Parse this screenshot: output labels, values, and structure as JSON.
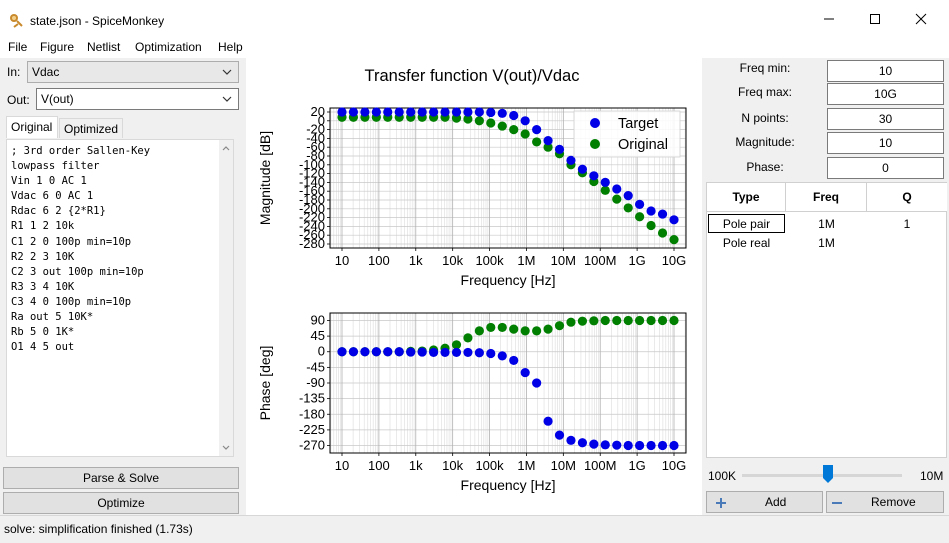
{
  "window": {
    "title": "state.json - SpiceMonkey",
    "minimize": "—",
    "maximize": "☐",
    "close": "✕"
  },
  "menu": [
    "File",
    "Figure",
    "Netlist",
    "Optimization",
    "Help"
  ],
  "left_panel": {
    "in_label": "In:",
    "in_value": "Vdac",
    "out_label": "Out:",
    "out_value": "V(out)",
    "tabs": [
      "Original",
      "Optimized"
    ],
    "netlist_lines": [
      "; 3rd order Sallen-Key",
      "lowpass filter",
      "Vin 1 0 AC 1",
      "Vdac 6 0 AC 1",
      "Rdac 6 2 {2*R1}",
      "R1 1 2 10k",
      "C1 2 0 100p min=10p",
      "R2 2 3 10K",
      "C2 3 out 100p min=10p",
      "R3 3 4 10K",
      "C3 4 0 100p min=10p",
      "Ra out 5 10K*",
      "Rb 5 0 1K*",
      "O1 4 5 out"
    ],
    "parse_button": "Parse & Solve",
    "optimize_button": "Optimize"
  },
  "right_panel": {
    "params": [
      {
        "label": "Freq min:",
        "value": "10"
      },
      {
        "label": "Freq max:",
        "value": "10G"
      },
      {
        "label": "N points:",
        "value": "30"
      },
      {
        "label": "Magnitude:",
        "value": "10"
      },
      {
        "label": "Phase:",
        "value": "0"
      }
    ],
    "table_headers": [
      "Type",
      "Freq",
      "Q"
    ],
    "table_rows": [
      {
        "type": "Pole pair",
        "freq": "1M",
        "q": "1"
      },
      {
        "type": "Pole real",
        "freq": "1M",
        "q": ""
      }
    ],
    "slider_min": "100K",
    "slider_max": "10M",
    "slider_level": 0.54,
    "add_button": "Add",
    "remove_button": "Remove"
  },
  "status": "solve: simplification finished (1.73s)",
  "chart_data": [
    {
      "type": "scatter",
      "title": "Transfer function V(out)/Vdac",
      "xlabel": "Frequency [Hz]",
      "ylabel": "Magnitude [dB]",
      "xscale": "log",
      "xlim": [
        10,
        10000000000
      ],
      "ylim": [
        -280,
        20
      ],
      "xticks": [
        "10",
        "100",
        "1k",
        "10k",
        "100k",
        "1M",
        "10M",
        "100M",
        "1G",
        "10G"
      ],
      "yticks": [
        "20",
        "0",
        "-20",
        "-40",
        "-60",
        "-80",
        "-100",
        "-120",
        "-140",
        "-160",
        "-180",
        "-200",
        "-220",
        "-240",
        "-260",
        "-280"
      ],
      "grid": true,
      "legend": "upper right",
      "x": [
        10,
        20.4,
        41.8,
        85.3,
        174,
        356,
        728,
        1490,
        3040,
        6210,
        12700,
        25900,
        52900,
        108000,
        221000,
        452000,
        924000,
        1890000,
        3860000,
        7880000,
        16100000,
        32900000,
        67200000,
        137000000,
        281000000,
        574000000,
        1170000000,
        2390000000,
        4890000000,
        10000000000
      ],
      "series": [
        {
          "name": "Target",
          "color": "#0000e6",
          "values": [
            20,
            20,
            20,
            20,
            20,
            20,
            20,
            20,
            20,
            20,
            20,
            20,
            20,
            19,
            17,
            12,
            0,
            -20,
            -45,
            -65,
            -90,
            -110,
            -125,
            -140,
            -155,
            -170,
            -190,
            -205,
            -212,
            -225
          ]
        },
        {
          "name": "Original",
          "color": "#007f00",
          "values": [
            8,
            8,
            8,
            8,
            8,
            8,
            8,
            8,
            8,
            8,
            6,
            4,
            0,
            -5,
            -12,
            -20,
            -30,
            -48,
            -60,
            -75,
            -100,
            -118,
            -138,
            -158,
            -178,
            -198,
            -218,
            -238,
            -255,
            -270
          ]
        }
      ]
    },
    {
      "type": "scatter",
      "title": "",
      "xlabel": "Frequency [Hz]",
      "ylabel": "Phase [deg]",
      "xscale": "log",
      "xlim": [
        10,
        10000000000
      ],
      "ylim": [
        -280,
        100
      ],
      "xticks": [
        "10",
        "100",
        "1k",
        "10k",
        "100k",
        "1M",
        "10M",
        "100M",
        "1G",
        "10G"
      ],
      "yticks": [
        "90",
        "45",
        "0",
        "-45",
        "-90",
        "-135",
        "-180",
        "-225",
        "-270"
      ],
      "grid": true,
      "x": [
        10,
        20.4,
        41.8,
        85.3,
        174,
        356,
        728,
        1490,
        3040,
        6210,
        12700,
        25900,
        52900,
        108000,
        221000,
        452000,
        924000,
        1890000,
        3860000,
        7880000,
        16100000,
        32900000,
        67200000,
        137000000,
        281000000,
        574000000,
        1170000000,
        2390000000,
        4890000000,
        10000000000
      ],
      "series": [
        {
          "name": "Target",
          "color": "#0000e6",
          "values": [
            0,
            0,
            0,
            0,
            0,
            0,
            -1,
            -1,
            -2,
            -2,
            -2,
            -2,
            -3,
            -5,
            -12,
            -25,
            -60,
            -90,
            -200,
            -240,
            -255,
            -262,
            -266,
            -268,
            -269,
            -270,
            -270,
            -270,
            -270,
            -270
          ]
        },
        {
          "name": "Original",
          "color": "#007f00",
          "values": [
            0,
            0,
            0,
            0,
            0,
            0,
            1,
            2,
            5,
            10,
            20,
            40,
            60,
            70,
            70,
            65,
            60,
            60,
            65,
            75,
            85,
            88,
            89,
            90,
            90,
            90,
            90,
            90,
            90,
            90
          ]
        }
      ]
    }
  ]
}
